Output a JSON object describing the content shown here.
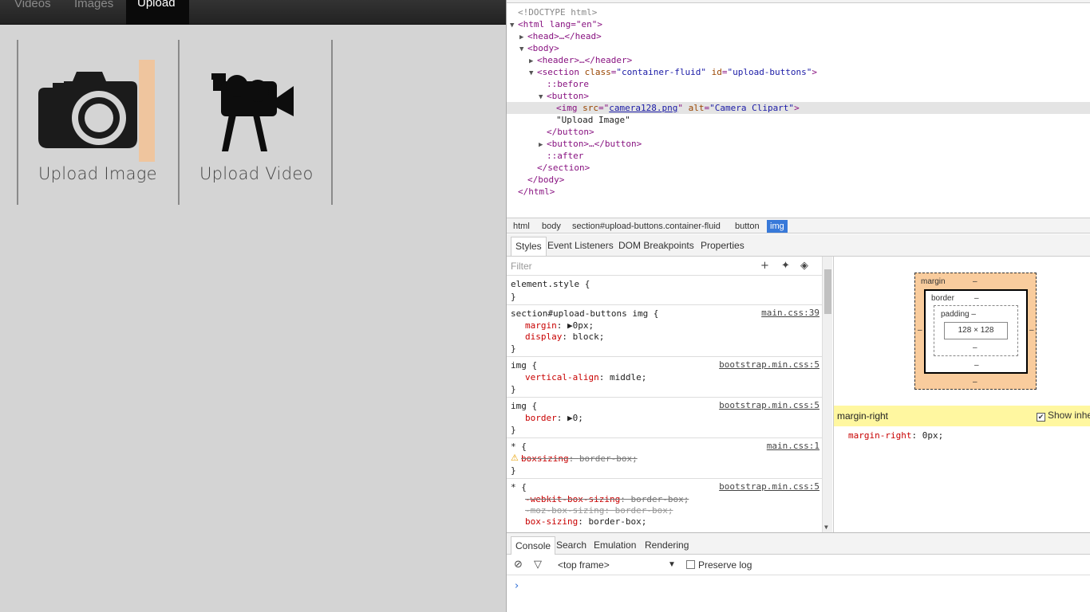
{
  "nav": {
    "items": [
      "Videos",
      "Images",
      "Upload"
    ]
  },
  "upload": {
    "image_label": "Upload Image",
    "video_label": "Upload Video"
  },
  "colors": {
    "margin_highlight": "#f3c294",
    "selection": "#3879d9",
    "attr_name": "#994500",
    "tag": "#881280",
    "property": "#c80000"
  },
  "icons": {
    "camera": "camera-icon",
    "video": "video-camera-icon"
  },
  "dom": {
    "doctype": "<!DOCTYPE html>",
    "html_open": "<html lang=\"en\">",
    "head": "<head>…</head>",
    "body_open": "<body>",
    "header": "<header>…</header>",
    "section_tag": "section",
    "section_class_attr": "class",
    "section_class_val": "\"container-fluid\"",
    "section_id_attr": "id",
    "section_id_val": "\"upload-buttons\"",
    "before": "::before",
    "button_open": "<button>",
    "img_tag": "img",
    "img_src_attr": "src",
    "img_src_val": "camera128.png",
    "img_alt_attr": "alt",
    "img_alt_val": "\"Camera Clipart\"",
    "text_node": "\"Upload Image\"",
    "button_close": "</button>",
    "button_collapsed": "<button>…</button>",
    "after": "::after",
    "section_close": "</section>",
    "body_close": "</body>",
    "html_close": "</html>"
  },
  "breadcrumbs": [
    "html",
    "body",
    "section#upload-buttons.container-fluid",
    "button",
    "img"
  ],
  "subtabs": [
    "Styles",
    "Event Listeners",
    "DOM Breakpoints",
    "Properties"
  ],
  "styles": {
    "filter_placeholder": "Filter",
    "rules": [
      {
        "selector": "element.style {",
        "source": "",
        "props": []
      },
      {
        "selector": "section#upload-buttons img {",
        "source": "main.css:39",
        "props": [
          {
            "name": "margin",
            "value": "▶0px;"
          },
          {
            "name": "display",
            "value": "block;"
          }
        ]
      },
      {
        "selector": "img {",
        "source": "bootstrap.min.css:5",
        "props": [
          {
            "name": "vertical-align",
            "value": "middle;"
          }
        ]
      },
      {
        "selector": "img {",
        "source": "bootstrap.min.css:5",
        "props": [
          {
            "name": "border",
            "value": "▶0;"
          }
        ]
      },
      {
        "selector": "* {",
        "source": "main.css:1",
        "props": [
          {
            "name": "boxsizing",
            "value": "border-box;"
          }
        ]
      },
      {
        "selector": "* {",
        "source": "bootstrap.min.css:5",
        "props": [
          {
            "name": "-webkit-box-sizing",
            "value": "border-box;"
          },
          {
            "name": "-moz-box-sizing",
            "value": "border-box;"
          },
          {
            "name": "box-sizing",
            "value": "border-box;"
          }
        ]
      }
    ],
    "close_brace": "}"
  },
  "metrics": {
    "margin_label": "margin",
    "border_label": "border",
    "padding_label": "padding",
    "content_size": "128 × 128",
    "dash": "–",
    "dash_padding": "padding –"
  },
  "computed": {
    "filter_value": "margin-right",
    "show_inherited": "Show inhe",
    "prop_name": "margin-right",
    "prop_value": "0px;"
  },
  "console": {
    "tabs": [
      "Console",
      "Search",
      "Emulation",
      "Rendering"
    ],
    "frame": "<top frame>",
    "preserve_log": "Preserve log",
    "prompt": "›"
  }
}
